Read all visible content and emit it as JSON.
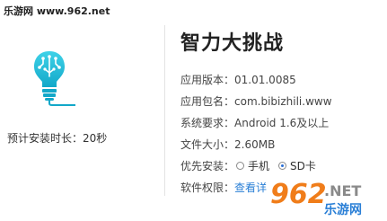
{
  "watermark": {
    "top_left": "乐游网 www.962.net"
  },
  "app": {
    "title": "智力大挑战",
    "install_time_label": "预计安装时长：20秒"
  },
  "info": {
    "version_label": "应用版本：",
    "version_value": "01.01.0085",
    "package_label": "应用包名：",
    "package_value": "com.bibizhili.www",
    "system_label": "系统要求：",
    "system_value": "Android 1.6及以上",
    "size_label": "文件大小：",
    "size_value": "2.60MB",
    "install_pref_label": "优先安装：",
    "install_options": [
      {
        "label": "手机",
        "selected": false
      },
      {
        "label": "SD卡",
        "selected": true
      }
    ],
    "permission_label": "软件权限：",
    "permission_link": "查看详"
  },
  "brand": {
    "logo_text": "962",
    "logo_suffix": ".NET",
    "logo_subtext": "乐游网",
    "primary_color": "#f07d1a",
    "accent_color": "#2a7fd6"
  },
  "icons": {
    "app_icon": "lightbulb-brain-icon"
  }
}
